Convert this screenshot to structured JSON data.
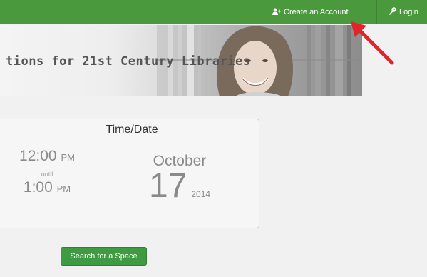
{
  "nav": {
    "create_account_label": "Create an Account",
    "login_label": "Login"
  },
  "banner": {
    "title": "tions for 21st Century Libraries"
  },
  "panel": {
    "title": "Time/Date",
    "start_time": "12:00",
    "start_ampm": "PM",
    "until_label": "until",
    "end_time": "1:00",
    "end_ampm": "PM",
    "month": "October",
    "day": "17",
    "year": "2014"
  },
  "actions": {
    "search_label": "Search for a Space"
  },
  "colors": {
    "nav_green": "#4a9a3d",
    "button_green": "#3f9b41",
    "arrow_red": "#e0242a"
  }
}
